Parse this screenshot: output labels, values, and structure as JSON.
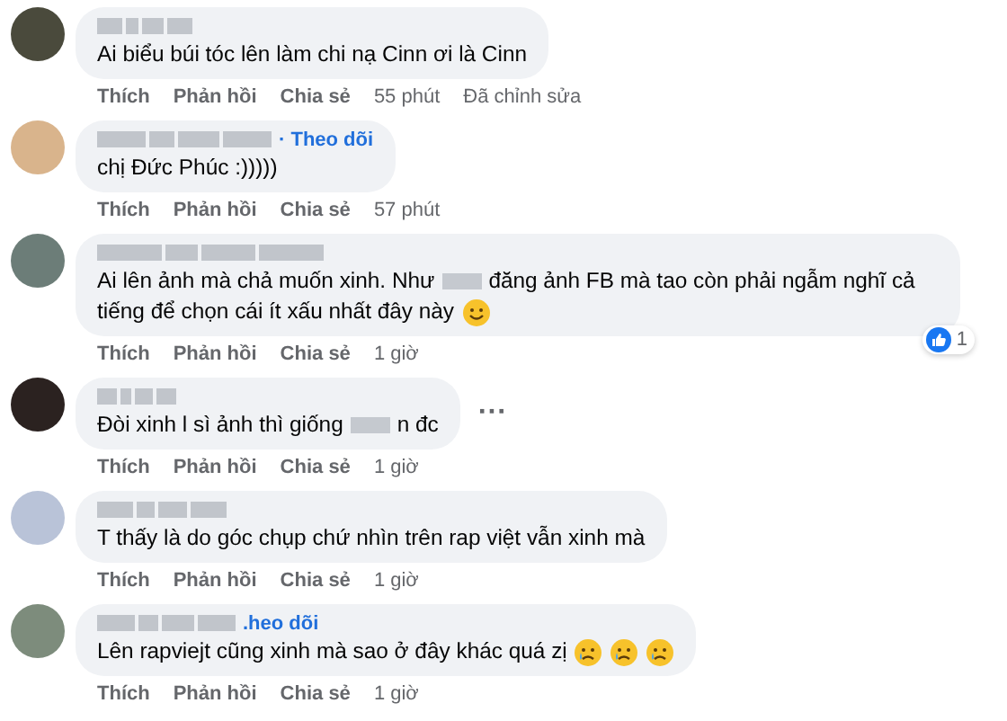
{
  "comments": [
    {
      "message": [
        {
          "kind": "text",
          "text": "Ai biểu búi tóc lên làm chi nạ Cinn ơi là Cinn"
        }
      ],
      "actions": [
        "Thích",
        "Phản hồi",
        "Chia sẻ"
      ],
      "time": "55 phút",
      "edited": "Đã chỉnh sửa"
    },
    {
      "follow": "· Theo dõi",
      "message": [
        {
          "kind": "text",
          "text": "chị Đức Phúc :)))))"
        }
      ],
      "actions": [
        "Thích",
        "Phản hồi",
        "Chia sẻ"
      ],
      "time": "57 phút"
    },
    {
      "message": [
        {
          "kind": "text",
          "text": "Ai lên ảnh mà chả muốn xinh. Như"
        },
        {
          "kind": "redacted"
        },
        {
          "kind": "text",
          "text": "đăng ảnh FB mà tao còn phải ngẫm nghĩ cả"
        },
        {
          "kind": "text",
          "text": "tiếng để chọn cái ít xấu nhất đây này"
        },
        {
          "kind": "smile"
        }
      ],
      "reaction": "1",
      "actions": [
        "Thích",
        "Phản hồi",
        "Chia sẻ"
      ],
      "time": "1 giờ"
    },
    {
      "message": [
        {
          "kind": "text",
          "text": "Đòi xinh l sì ảnh thì giống"
        },
        {
          "kind": "redacted"
        },
        {
          "kind": "text",
          "text": "n đc"
        }
      ],
      "more": "···",
      "actions": [
        "Thích",
        "Phản hồi",
        "Chia sẻ"
      ],
      "time": "1 giờ"
    },
    {
      "message": [
        {
          "kind": "text",
          "text": "T thấy là do góc chụp chứ nhìn trên rap việt vẫn xinh mà"
        }
      ],
      "actions": [
        "Thích",
        "Phản hồi",
        "Chia sẻ"
      ],
      "time": "1 giờ"
    },
    {
      "follow": ".heo dõi",
      "message": [
        {
          "kind": "text",
          "text": "Lên rapviejt cũng xinh mà sao ở đây khác quá zị"
        },
        {
          "kind": "cry"
        },
        {
          "kind": "cry"
        },
        {
          "kind": "cry"
        }
      ],
      "actions": [
        "Thích",
        "Phản hồi",
        "Chia sẻ"
      ],
      "time": "1 giờ"
    }
  ]
}
